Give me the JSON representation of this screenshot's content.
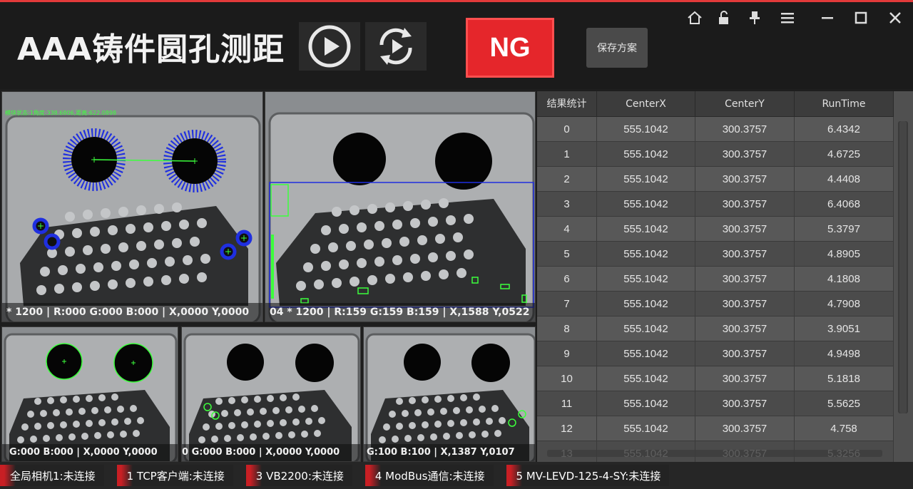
{
  "app": {
    "title": "AAA铸件圆孔测距",
    "result_badge": "NG",
    "save_label": "保存方案",
    "colors": {
      "ng": "#e5262b",
      "accent": "#e23a3a",
      "overlay_green": "#3cff3c",
      "overlay_blue": "#1f2fe0"
    }
  },
  "header_icons": {
    "run": "play-icon",
    "cycle": "cycle-run-icon"
  },
  "window_controls": [
    "home-icon",
    "unlock-icon",
    "pin-icon",
    "menu-icon",
    "minimize-icon",
    "maximize-icon",
    "close-icon"
  ],
  "panels": {
    "p1": {
      "overlay": "模块状态:1角度:338.6806,距离:622.0898",
      "status": "* 1200  |  R:000  G:000  B:000  |  X,0000  Y,0000"
    },
    "p2": {
      "status": "04 * 1200  |  R:159  G:159  B:159  |  X,1588  Y,0522"
    },
    "p3": {
      "status": "G:000  B:000  |  X,0000  Y,0000"
    },
    "p4": {
      "status": "0  G:000  B:000  |  X,0000  Y,0000"
    },
    "p5": {
      "status": "G:100  B:100  |  X,1387  Y,0107"
    }
  },
  "table": {
    "headers": [
      "结果统计",
      "CenterX",
      "CenterY",
      "RunTime"
    ],
    "rows": [
      [
        "0",
        "555.1042",
        "300.3757",
        "6.4342"
      ],
      [
        "1",
        "555.1042",
        "300.3757",
        "4.6725"
      ],
      [
        "2",
        "555.1042",
        "300.3757",
        "4.4408"
      ],
      [
        "3",
        "555.1042",
        "300.3757",
        "6.4068"
      ],
      [
        "4",
        "555.1042",
        "300.3757",
        "5.3797"
      ],
      [
        "5",
        "555.1042",
        "300.3757",
        "4.8905"
      ],
      [
        "6",
        "555.1042",
        "300.3757",
        "4.1808"
      ],
      [
        "7",
        "555.1042",
        "300.3757",
        "4.7908"
      ],
      [
        "8",
        "555.1042",
        "300.3757",
        "3.9051"
      ],
      [
        "9",
        "555.1042",
        "300.3757",
        "4.9498"
      ],
      [
        "10",
        "555.1042",
        "300.3757",
        "5.1818"
      ],
      [
        "11",
        "555.1042",
        "300.3757",
        "5.5625"
      ],
      [
        "12",
        "555.1042",
        "300.3757",
        "4.758"
      ],
      [
        "13",
        "555.1042",
        "300.3757",
        "5.3256"
      ]
    ]
  },
  "statusbar": [
    "全局相机1:未连接",
    "1 TCP客户端:未连接",
    "3 VB2200:未连接",
    "4 ModBus通信:未连接",
    "5 MV-LEVD-125-4-SY:未连接"
  ]
}
